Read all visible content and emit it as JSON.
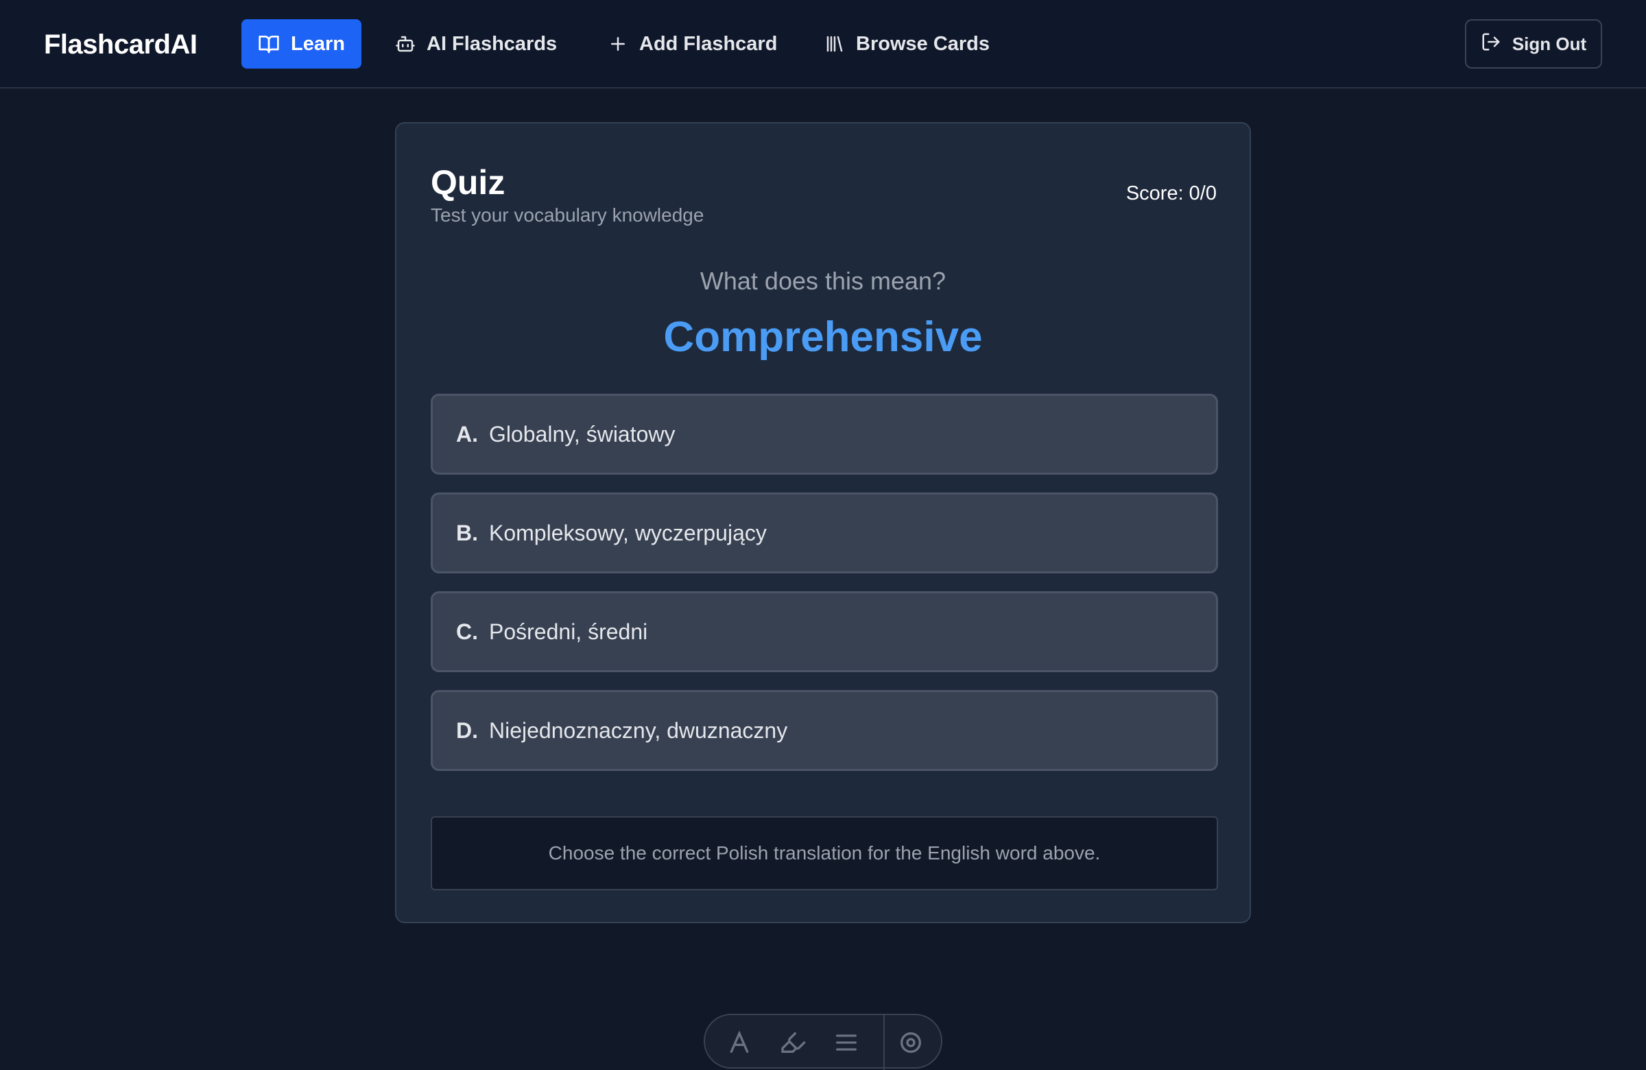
{
  "header": {
    "brand": "FlashcardAI",
    "nav": [
      {
        "label": "Learn",
        "icon": "book-open-icon",
        "active": true
      },
      {
        "label": "AI Flashcards",
        "icon": "bot-icon",
        "active": false
      },
      {
        "label": "Add Flashcard",
        "icon": "plus-icon",
        "active": false
      },
      {
        "label": "Browse Cards",
        "icon": "library-icon",
        "active": false
      }
    ],
    "sign_out": {
      "label": "Sign Out",
      "icon": "log-out-icon"
    }
  },
  "quiz": {
    "title": "Quiz",
    "subtitle": "Test your vocabulary knowledge",
    "score": "Score: 0/0",
    "prompt": "What does this mean?",
    "word": "Comprehensive",
    "options": [
      {
        "letter": "A.",
        "text": "Globalny, światowy"
      },
      {
        "letter": "B.",
        "text": "Kompleksowy, wyczerpujący"
      },
      {
        "letter": "C.",
        "text": "Pośredni, średni"
      },
      {
        "letter": "D.",
        "text": "Niejednoznaczny, dwuznaczny"
      }
    ],
    "hint": "Choose the correct Polish translation for the English word above."
  },
  "colors": {
    "background": "#111827",
    "header_bg": "#0f172a",
    "card_bg": "#1e293b",
    "accent": "#1d63f5",
    "word": "#4a9cf5",
    "option_bg": "#374152"
  },
  "bottom_toolbar": {
    "icons": [
      "text-icon",
      "highlighter-icon",
      "menu-icon",
      "settings-icon"
    ]
  }
}
